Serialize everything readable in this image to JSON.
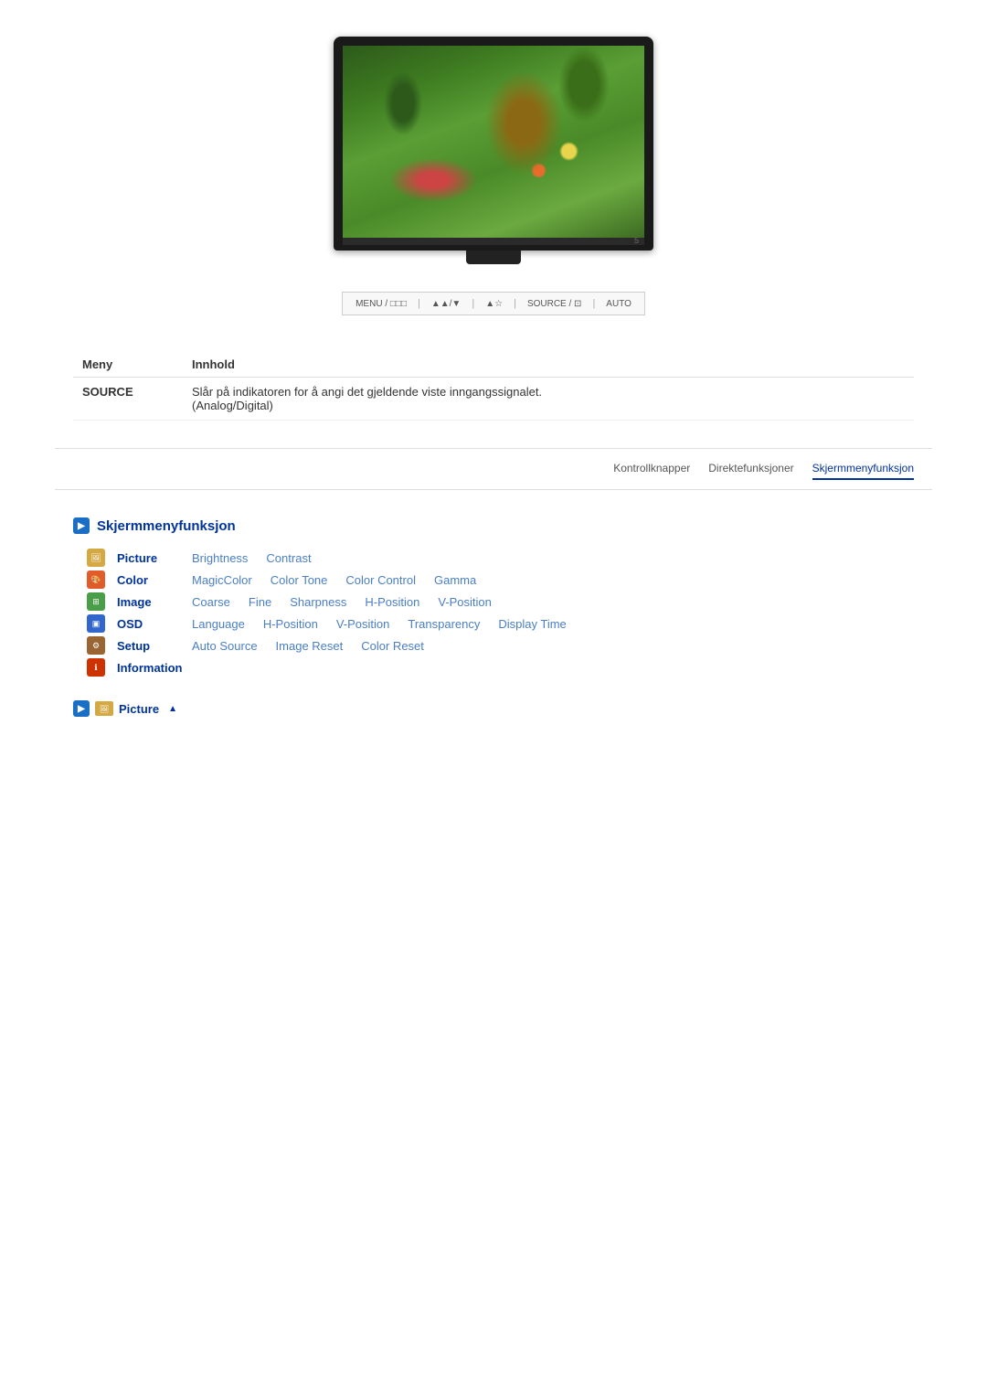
{
  "monitor": {
    "alt": "Samsung monitor display"
  },
  "control_bar": {
    "items": [
      {
        "label": "MENU / □□□",
        "key": "menu"
      },
      {
        "label": "▲▲/▼",
        "key": "brightness"
      },
      {
        "label": "▲☆",
        "key": "source_adjust"
      },
      {
        "label": "SOURCE / ⊡",
        "key": "source"
      },
      {
        "label": "AUTO",
        "key": "auto"
      }
    ]
  },
  "table": {
    "col1_header": "Meny",
    "col2_header": "Innhold",
    "rows": [
      {
        "label": "SOURCE",
        "content": "Slår på indikatoren for å angi det gjeldende viste inngangssignalet.\n(Analog/Digital)"
      }
    ]
  },
  "tabs": [
    {
      "label": "Kontrollknapper",
      "active": false
    },
    {
      "label": "Direktefunksjoner",
      "active": false
    },
    {
      "label": "Skjermmenyfunksjon",
      "active": true
    }
  ],
  "screen_menu": {
    "section_title": "Skjermmenyfunksjon",
    "categories": [
      {
        "key": "picture",
        "icon_type": "icon-picture",
        "icon_char": "🖼",
        "label": "Picture",
        "items": [
          "Brightness",
          "Contrast"
        ]
      },
      {
        "key": "color",
        "icon_type": "icon-color",
        "icon_char": "🎨",
        "label": "Color",
        "items": [
          "MagicColor",
          "Color Tone",
          "Color Control",
          "Gamma"
        ]
      },
      {
        "key": "image",
        "icon_type": "icon-image",
        "icon_char": "🖼",
        "label": "Image",
        "items": [
          "Coarse",
          "Fine",
          "Sharpness",
          "H-Position",
          "V-Position"
        ]
      },
      {
        "key": "osd",
        "icon_type": "icon-osd",
        "icon_char": "📺",
        "label": "OSD",
        "items": [
          "Language",
          "H-Position",
          "V-Position",
          "Transparency",
          "Display Time"
        ]
      },
      {
        "key": "setup",
        "icon_type": "icon-setup",
        "icon_char": "⚙",
        "label": "Setup",
        "items": [
          "Auto Source",
          "Image Reset",
          "Color Reset"
        ]
      },
      {
        "key": "information",
        "icon_type": "icon-info",
        "icon_char": "ℹ",
        "label": "Information",
        "items": []
      }
    ]
  },
  "breadcrumb": {
    "label": "Picture",
    "arrow": "▲"
  }
}
